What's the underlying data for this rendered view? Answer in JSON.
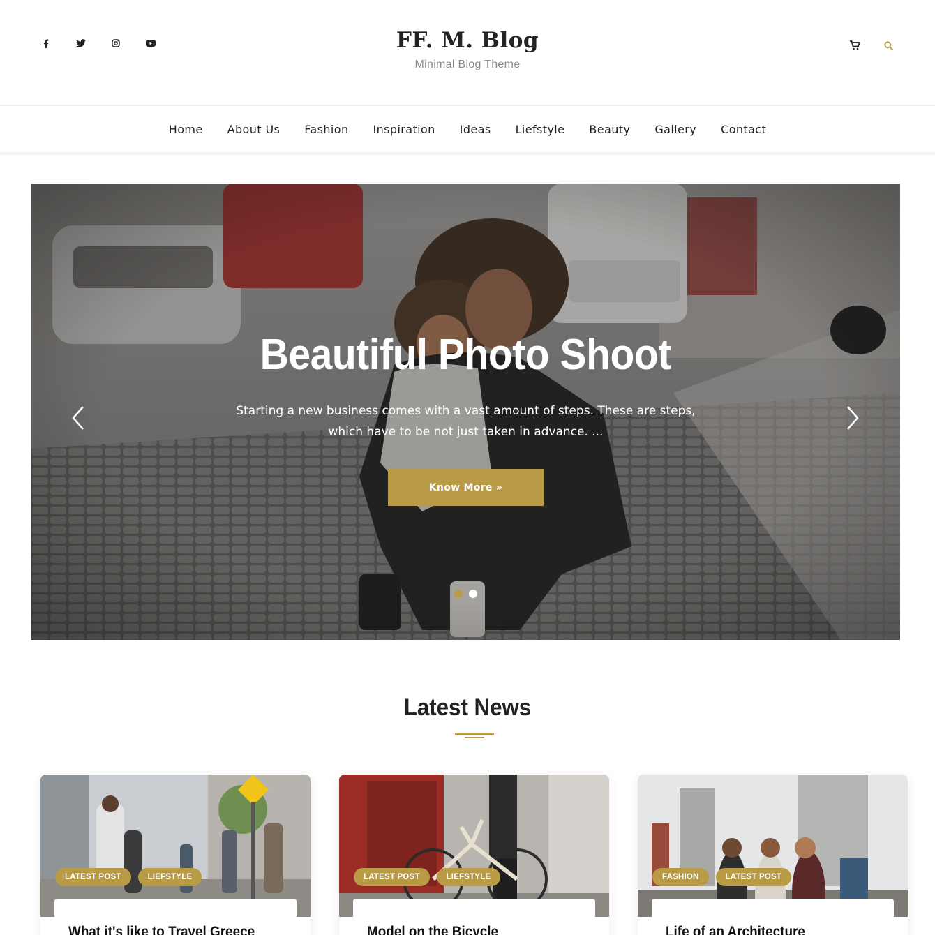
{
  "header": {
    "site_title": "FF. M. Blog",
    "site_tagline": "Minimal Blog Theme",
    "social_icons": [
      "facebook-icon",
      "twitter-icon",
      "instagram-icon",
      "youtube-icon"
    ],
    "action_icons": [
      "cart-icon",
      "search-icon"
    ]
  },
  "nav": {
    "items": [
      "Home",
      "About Us",
      "Fashion",
      "Inspiration",
      "Ideas",
      "Liefstyle",
      "Beauty",
      "Gallery",
      "Contact"
    ]
  },
  "slider": {
    "title": "Beautiful Photo Shoot",
    "text": "Starting a new business comes with a vast amount of steps. These are steps, which have to be not just taken in advance. ...",
    "button_label": "Know More »",
    "slide_count": 2,
    "active_slide": 1
  },
  "latest_news": {
    "heading": "Latest News",
    "posts": [
      {
        "badges": [
          "LATEST POST",
          "LIEFSTYLE"
        ],
        "title": "What it's like to Travel Greece"
      },
      {
        "badges": [
          "LATEST POST",
          "LIEFSTYLE"
        ],
        "title": "Model on the Bicycle"
      },
      {
        "badges": [
          "FASHION",
          "LATEST POST"
        ],
        "title": "Life of an Architecture"
      }
    ]
  },
  "colors": {
    "accent": "#b99a45",
    "text": "#222222",
    "muted": "#8a8a8a"
  }
}
